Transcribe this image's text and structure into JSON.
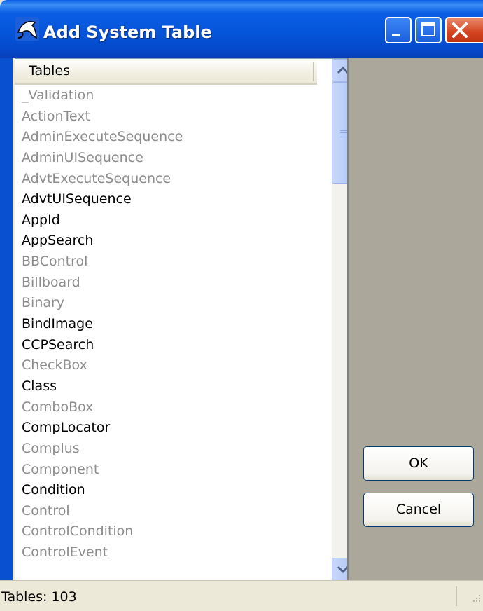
{
  "window": {
    "title": "Add System Table",
    "icon": "dolphin-app-icon",
    "controls": [
      "minimize",
      "maximize",
      "close"
    ]
  },
  "list": {
    "header": "Tables",
    "items": [
      {
        "label": "_Validation",
        "state": "dim"
      },
      {
        "label": "ActionText",
        "state": "dim"
      },
      {
        "label": "AdminExecuteSequence",
        "state": "dim"
      },
      {
        "label": "AdminUISequence",
        "state": "dim"
      },
      {
        "label": "AdvtExecuteSequence",
        "state": "dim"
      },
      {
        "label": "AdvtUISequence",
        "state": "normal"
      },
      {
        "label": "AppId",
        "state": "normal"
      },
      {
        "label": "AppSearch",
        "state": "normal"
      },
      {
        "label": "BBControl",
        "state": "dim"
      },
      {
        "label": "Billboard",
        "state": "dim"
      },
      {
        "label": "Binary",
        "state": "dim"
      },
      {
        "label": "BindImage",
        "state": "normal"
      },
      {
        "label": "CCPSearch",
        "state": "normal"
      },
      {
        "label": "CheckBox",
        "state": "dim"
      },
      {
        "label": "Class",
        "state": "normal"
      },
      {
        "label": "ComboBox",
        "state": "dim"
      },
      {
        "label": "CompLocator",
        "state": "normal"
      },
      {
        "label": "Complus",
        "state": "dim"
      },
      {
        "label": "Component",
        "state": "dim"
      },
      {
        "label": "Condition",
        "state": "normal"
      },
      {
        "label": "Control",
        "state": "dim"
      },
      {
        "label": "ControlCondition",
        "state": "dim"
      },
      {
        "label": "ControlEvent",
        "state": "dim"
      }
    ]
  },
  "buttons": {
    "ok": "OK",
    "cancel": "Cancel"
  },
  "statusbar": {
    "text": "Tables: 103"
  },
  "colors": {
    "titlebar": "#0553d7",
    "dim_text": "#8c8c8c",
    "panel_bg": "#aba89b"
  }
}
